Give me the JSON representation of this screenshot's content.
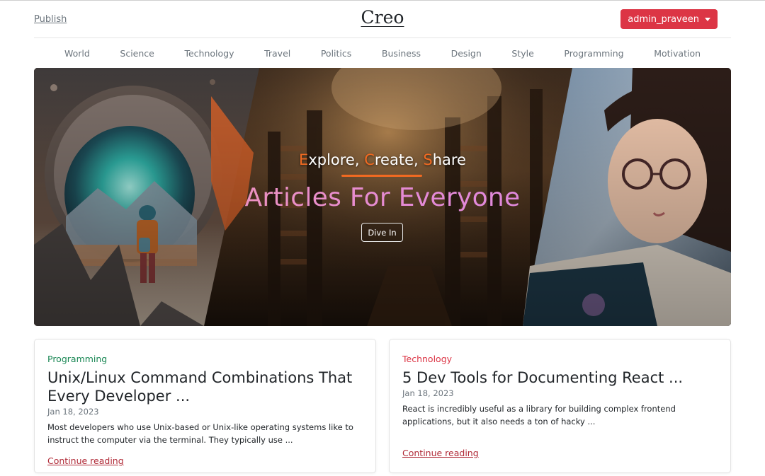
{
  "header": {
    "publish_label": "Publish",
    "brand": "Creo",
    "user_label": "admin_praveen"
  },
  "nav": [
    "World",
    "Science",
    "Technology",
    "Travel",
    "Politics",
    "Business",
    "Design",
    "Style",
    "Programming",
    "Motivation"
  ],
  "hero": {
    "tagline_parts": [
      {
        "hl": "E",
        "rest": "xplore, "
      },
      {
        "hl": "C",
        "rest": "reate, "
      },
      {
        "hl": "S",
        "rest": "hare"
      }
    ],
    "title": "Articles For Everyone",
    "button_label": "Dive In"
  },
  "cards": [
    {
      "category": "Programming",
      "title": "Unix/Linux Command Combinations That Every Developer ...",
      "date": "Jan 18, 2023",
      "excerpt": "Most developers who use Unix-based or Unix-like operating systems like to instruct the computer via the terminal. They typically use ...",
      "link_label": "Continue reading"
    },
    {
      "category": "Technology",
      "title": "5 Dev Tools for Documenting React ...",
      "date": "Jan 18, 2023",
      "excerpt": "React is incredibly useful as a library for building complex frontend applications, but it also needs a ton of hacky ...",
      "link_label": "Continue reading"
    }
  ],
  "colors": {
    "accent_red": "#dc3545",
    "accent_orange": "#f26a21",
    "category_green": "#198754",
    "link_red": "#b02a37"
  },
  "icons": {
    "user_menu": "caret-down-icon"
  }
}
